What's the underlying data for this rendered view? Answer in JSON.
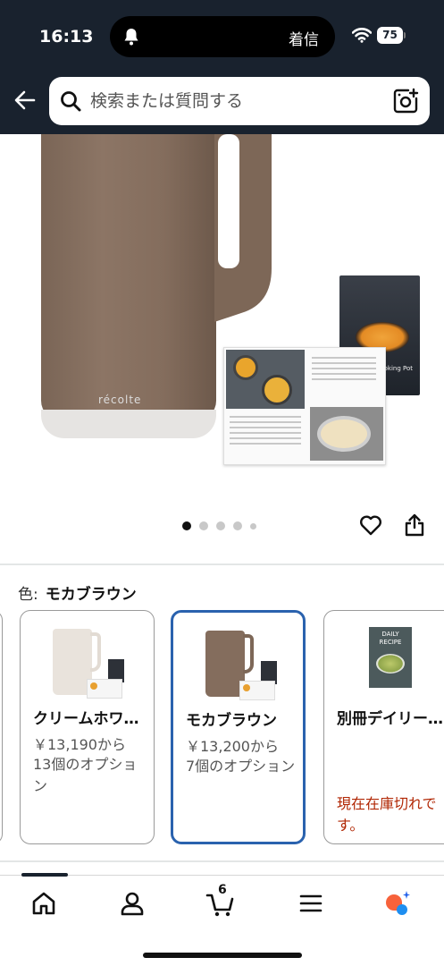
{
  "status_bar": {
    "time": "16:13",
    "notification_text": "着信",
    "battery": "75"
  },
  "header": {
    "search_placeholder": "検索または質問する"
  },
  "gallery": {
    "brand_logo_text": "récolte",
    "cover_text": "Auto Cooking Pot",
    "page_count": 5,
    "active_page": 1
  },
  "color_selector": {
    "label": "色:",
    "selected": "モカブラウン"
  },
  "variants": [
    {
      "title": "クリームホワイト",
      "price": "￥13,190から",
      "options": "13個のオプション",
      "availability": ""
    },
    {
      "title": "モカブラウン",
      "price": "￥13,200から",
      "options": "7個のオプション",
      "availability": ""
    },
    {
      "title": "別冊デイリーレシピ",
      "price": "",
      "options": "",
      "availability": "現在在庫切れです。"
    }
  ],
  "recipe_cover_text": "DAILY RECIPE",
  "bottom_nav": {
    "cart_count": "6",
    "items": [
      "home-icon",
      "account-icon",
      "cart-icon",
      "menu-icon",
      "rufus-icon"
    ]
  },
  "colors": {
    "header_bg": "#19222e",
    "selected_border": "#2a62ae",
    "out_of_stock": "#b12704",
    "mocha": "#846d5d",
    "cream": "#e9e3dc"
  }
}
